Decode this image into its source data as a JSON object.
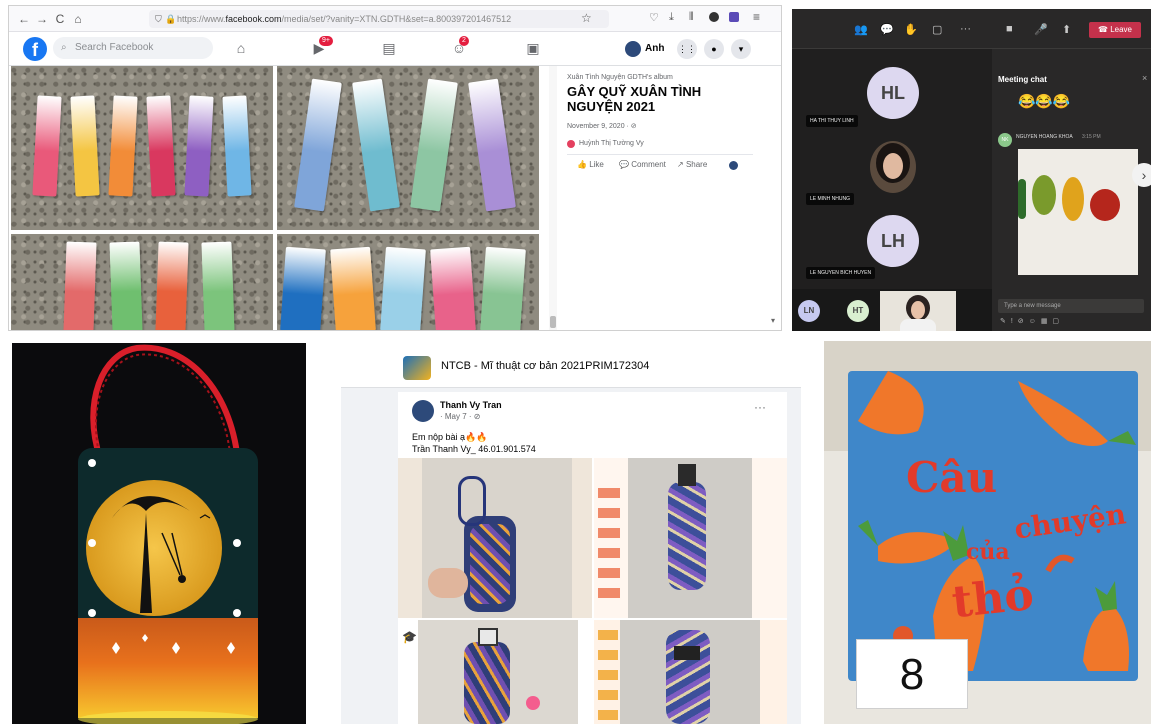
{
  "facebook_window": {
    "browser": {
      "nav_back": "←",
      "nav_forward": "→",
      "nav_reload": "C",
      "nav_home": "⌂",
      "url_prefix": "https://www.",
      "url_domain": "facebook.com",
      "url_rest": "/media/set/?vanity=XTN.GDTH&set=a.800397201467512",
      "star_icon": "☆"
    },
    "fb_header": {
      "logo_letter": "f",
      "search_placeholder": "Search Facebook",
      "notif_badge_1": "9+",
      "notif_badge_2": "2",
      "profile_name": "Anh"
    },
    "album": {
      "owner_label": "Xuân Tình Nguyện GDTH's album",
      "title": "GÂY QUỸ XUÂN TÌNH NGUYỆN 2021",
      "date": "November 9, 2020 · ⊘",
      "tagged_name": "Huỳnh Thị Tường Vy",
      "like_label": "Like",
      "comment_label": "Comment",
      "share_label": "Share"
    },
    "bookmark_colors": {
      "set1": [
        "#e9597a",
        "#f4c542",
        "#f28c38",
        "#d9385f",
        "#8e5fc2",
        "#6fb6e6"
      ],
      "set2": [
        "#7fa5d9",
        "#6fbccf",
        "#8dc6a3",
        "#a98fd6"
      ],
      "set3": [
        "#e36a6a",
        "#6fbf6f",
        "#e8613c",
        "#7cc47c"
      ],
      "set4": [
        "#1f6fc0",
        "#f6a23c",
        "#9ad0e8",
        "#e8628a",
        "#88c493"
      ]
    }
  },
  "teams_window": {
    "leave_label": "Leave",
    "participants": [
      {
        "initials": "HL",
        "name": "HA THI THUY LINH"
      },
      {
        "initials": "",
        "name": "LE MINH NHUNG"
      },
      {
        "initials": "LH",
        "name": "LE NGUYEN BICH HUYEN"
      }
    ],
    "bottom_avatars": [
      "LN",
      "HT"
    ],
    "chat": {
      "title": "Meeting chat",
      "emojis": "😂😂😂",
      "sender": "NGUYEN HOANG KHOA",
      "sender_initials": "NK",
      "time": "3:15 PM",
      "input_placeholder": "Type a new message"
    }
  },
  "group_post": {
    "group_name": "NTCB - Mĩ thuật cơ bản 2021PRIM172304",
    "author": "Thanh Vy Tran",
    "post_meta": "· May 7 · ⊘",
    "more_icon": "···",
    "body_line_1": "Em nộp bài ạ🔥🔥",
    "body_line_2": "Trần Thanh Vy_ 46.01.901.574"
  },
  "book": {
    "title_line_1": "Câu",
    "title_line_2": "chuyện",
    "title_line_3": "của",
    "title_line_4": "thỏ",
    "number_card": "8"
  }
}
